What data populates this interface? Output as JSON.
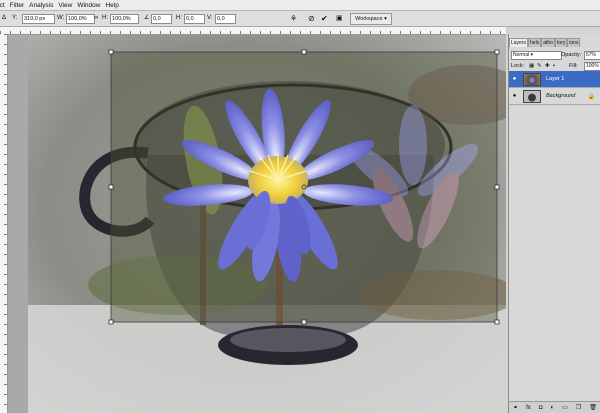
{
  "menu": [
    "ect",
    "Filter",
    "Analysis",
    "View",
    "Window",
    "Help"
  ],
  "options": {
    "y_label": "Y:",
    "y_value": "319,0 px",
    "w_label": "W:",
    "w_value": "100,0%",
    "h_label": "H:",
    "h_value": "100,0%",
    "angle_value": "0,0",
    "hskew_label": "H:",
    "hskew_value": "0,0",
    "vskew_label": "V:",
    "vskew_value": "0,0",
    "workspace_label": "Workspace"
  },
  "panel": {
    "tabs": [
      "Layers",
      "hels",
      "atho",
      "tory",
      "ions"
    ],
    "blend_mode": "Normal",
    "opacity_label": "Opacity:",
    "opacity_value": "57%",
    "lock_label": "Lock:",
    "fill_label": "Fill:",
    "fill_value": "100%",
    "layers": [
      {
        "name": "Layer 1",
        "selected": true
      },
      {
        "name": "Background",
        "selected": false,
        "locked": true
      }
    ]
  },
  "colors": {
    "selected_layer": "#3b6cc5",
    "petal": "#7a7fd6",
    "center": "#f2d23a",
    "pad": "#5d6a3a",
    "cup": "#2a2630"
  }
}
